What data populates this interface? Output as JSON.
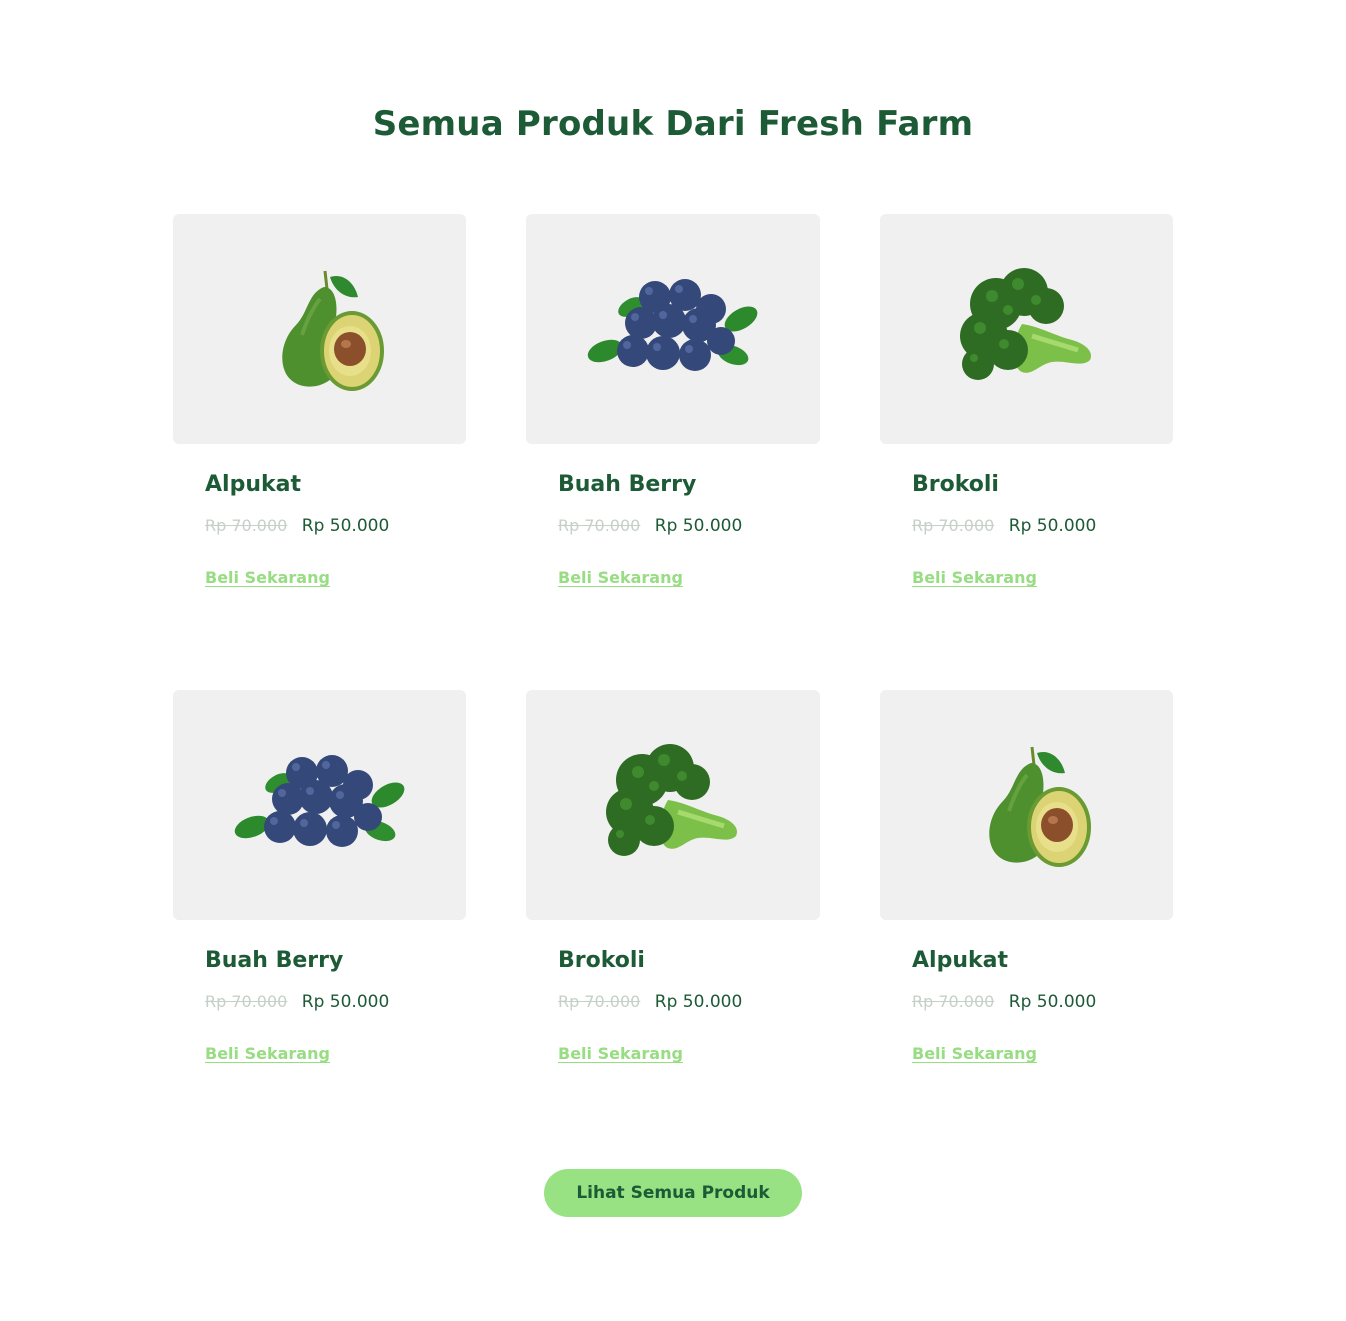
{
  "section": {
    "title": "Semua Produk Dari Fresh Farm"
  },
  "products": [
    {
      "name": "Alpukat",
      "old_price": "Rp 70.000",
      "price": "Rp 50.000",
      "cta": "Beli Sekarang",
      "icon": "avocado-icon"
    },
    {
      "name": "Buah Berry",
      "old_price": "Rp 70.000",
      "price": "Rp 50.000",
      "cta": "Beli Sekarang",
      "icon": "blueberry-icon"
    },
    {
      "name": "Brokoli",
      "old_price": "Rp 70.000",
      "price": "Rp 50.000",
      "cta": "Beli Sekarang",
      "icon": "broccoli-icon"
    },
    {
      "name": "Buah Berry",
      "old_price": "Rp 70.000",
      "price": "Rp 50.000",
      "cta": "Beli Sekarang",
      "icon": "blueberry-icon"
    },
    {
      "name": "Brokoli",
      "old_price": "Rp 70.000",
      "price": "Rp 50.000",
      "cta": "Beli Sekarang",
      "icon": "broccoli-icon"
    },
    {
      "name": "Alpukat",
      "old_price": "Rp 70.000",
      "price": "Rp 50.000",
      "cta": "Beli Sekarang",
      "icon": "avocado-icon"
    }
  ],
  "footer": {
    "view_all_label": "Lihat Semua Produk"
  },
  "colors": {
    "heading": "#1d5a36",
    "accent": "#98e283",
    "card_bg": "#f0f0f0",
    "old_price": "#c5d0c8"
  }
}
